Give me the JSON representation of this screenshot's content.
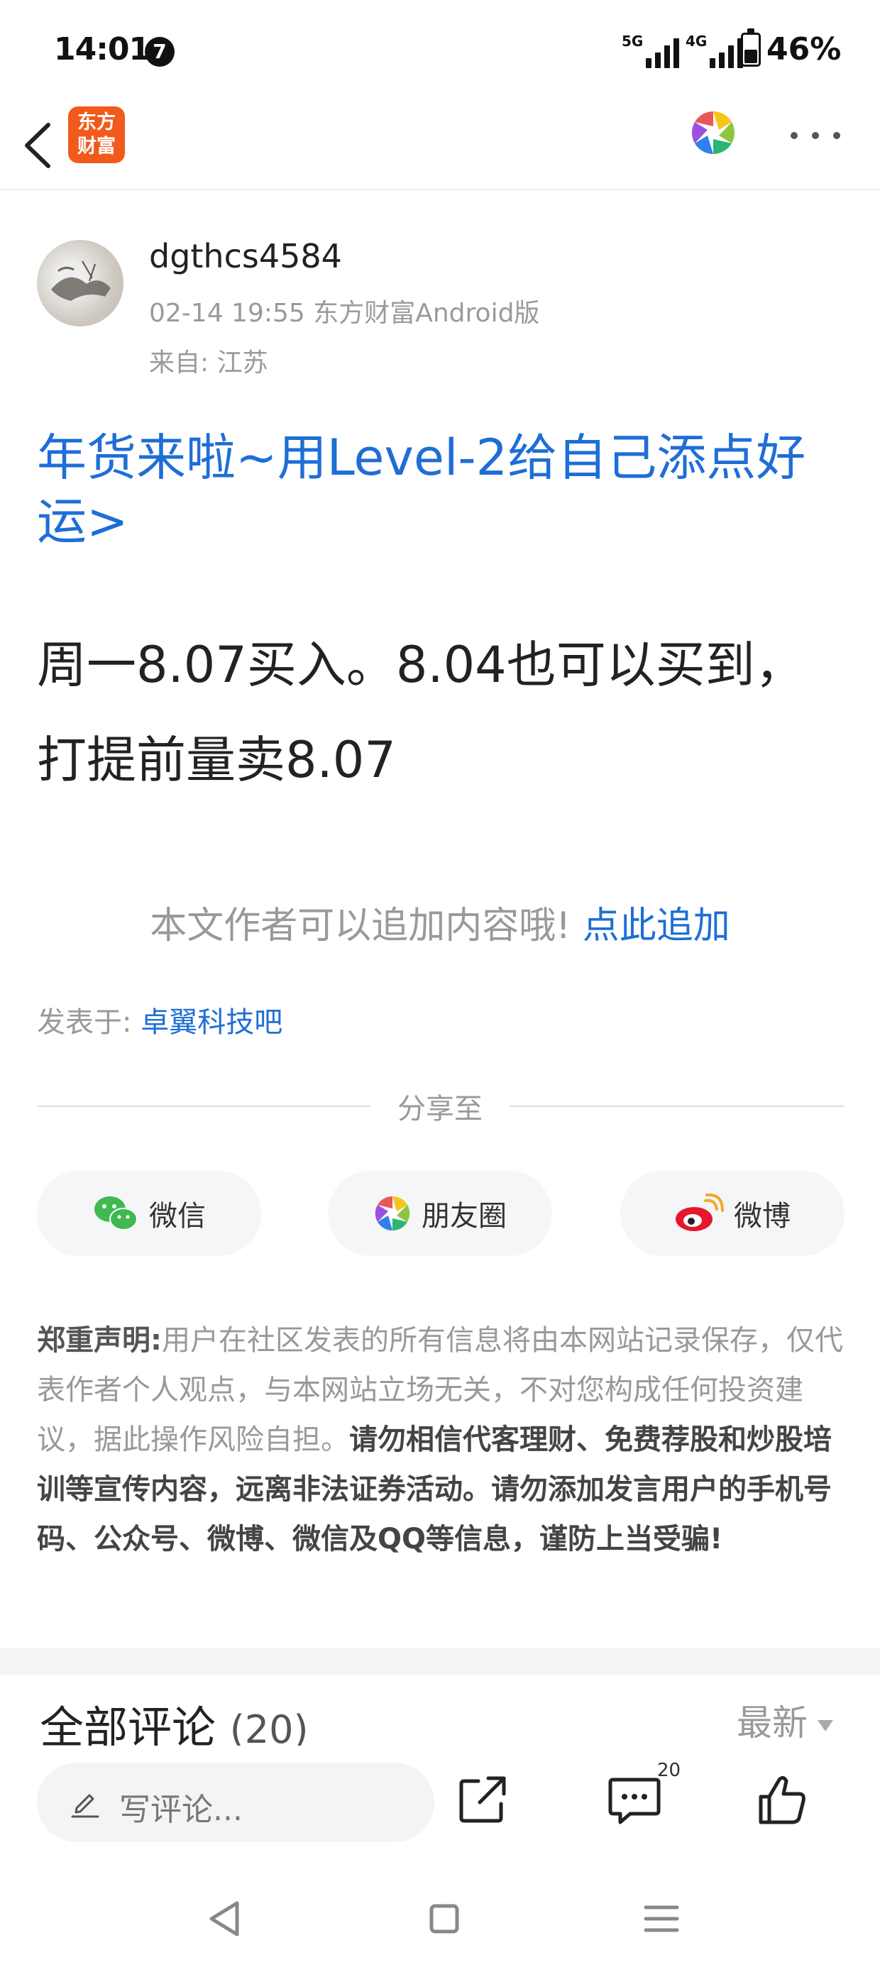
{
  "status_bar": {
    "time": "14:01",
    "notification_count": "7",
    "network_1": "5G",
    "network_2": "4G",
    "battery_level": 0.46,
    "battery_text": "46%"
  },
  "nav": {
    "logo_line1": "东方",
    "logo_line2": "财富",
    "logo_color": "#f25a1c"
  },
  "post": {
    "author": "dgthcs4584",
    "meta": "02-14 19:55 东方财富Android版",
    "location": "来自: 江苏",
    "title": "年货来啦~用Level-2给自己添点好运>",
    "body": "周一8.07买入。8.04也可以买到，打提前量卖8.07",
    "append_text": "本文作者可以追加内容哦!",
    "append_link": "点此追加",
    "posted_in_label": "发表于:",
    "forum_name": "卓翼科技吧"
  },
  "share": {
    "label": "分享至",
    "wechat": "微信",
    "moments": "朋友圈",
    "weibo": "微博"
  },
  "disclaimer": {
    "lead": "郑重声明",
    "colon": ":",
    "normal": "用户在社区发表的所有信息将由本网站记录保存，仅代表作者个人观点，与本网站立场无关，不对您构成任何投资建议，据此操作风险自担。",
    "strong": "请勿相信代客理财、免费荐股和炒股培训等宣传内容，远离非法证券活动。请勿添加发言用户的手机号码、公众号、微博、微信及QQ等信息，谨防上当受骗!"
  },
  "comments": {
    "heading": "全部评论",
    "count": "(20)",
    "sort": "最新"
  },
  "action_bar": {
    "input_placeholder": "写评论...",
    "comment_badge": "20"
  },
  "colors": {
    "link_blue": "#1e6ed6",
    "muted_gray": "#999999"
  },
  "icons": [
    "back-arrow-icon",
    "color-wheel-icon",
    "more-dots-icon",
    "wechat-icon",
    "moments-icon",
    "weibo-icon",
    "pencil-icon",
    "share-out-icon",
    "comment-icon",
    "thumbs-up-icon"
  ]
}
